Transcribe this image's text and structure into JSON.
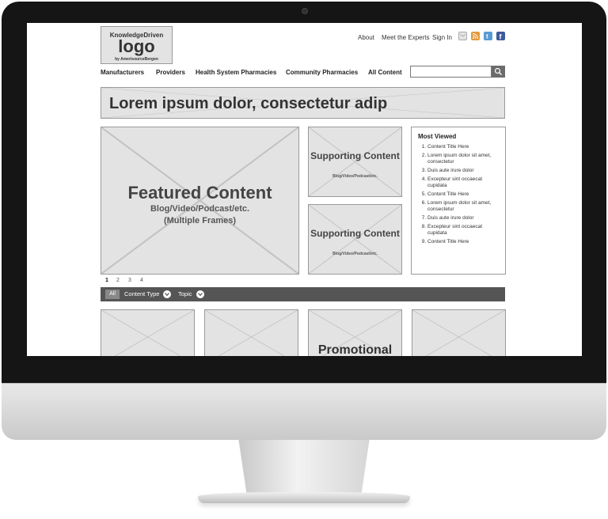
{
  "logo": {
    "line1": "KnowledgeDriven",
    "line2": "logo",
    "line3": "by AmerisourceBergen"
  },
  "toplinks": [
    "About",
    "Meet the Experts",
    "Sign In"
  ],
  "social_icons": [
    "mail-icon",
    "rss-icon",
    "twitter-icon",
    "facebook-icon"
  ],
  "nav": [
    "Manufacturers",
    "Providers",
    "Health System Pharmacies",
    "Community Pharmacies",
    "All Content"
  ],
  "search": {
    "placeholder": "",
    "icon": "search-icon"
  },
  "banner": {
    "title": "Lorem ipsum dolor, consectetur adip"
  },
  "featured": {
    "title": "Featured Content",
    "line2": "Blog/Video/Podcast/etc.",
    "line3": "(Multiple Frames)"
  },
  "supporting": [
    {
      "title": "Supporting Content",
      "sub": "Blog/Video/Podcast/etc."
    },
    {
      "title": "Supporting Content",
      "sub": "Blog/Video/Podcast/etc."
    }
  ],
  "most_viewed": {
    "heading": "Most Viewed",
    "items": [
      "Content Title Here",
      "Lorem ipsum dolor sit amet, consectetur",
      "Duis aute irure dolor",
      "Excepteur sint occaecat cupidata",
      "Content Title Here",
      "Lorem ipsum dolor sit amet, consectetur",
      "Duis aute irure dolor",
      "Excepteur sint occaecat cupidata",
      "Content Title Here"
    ]
  },
  "pager": {
    "pages": [
      "1",
      "2",
      "3",
      "4"
    ],
    "active": "1"
  },
  "filters": {
    "all": "All",
    "content_type": "Content Type",
    "topic": "Topic"
  },
  "tiles": [
    "",
    "",
    "Promotional",
    ""
  ],
  "colors": {
    "placeholder_bg": "#e3e3e3",
    "filterbar_bg": "#555555",
    "facebook": "#3b5b9a",
    "twitter": "#5a9ad3",
    "rss": "#e59a3a"
  }
}
